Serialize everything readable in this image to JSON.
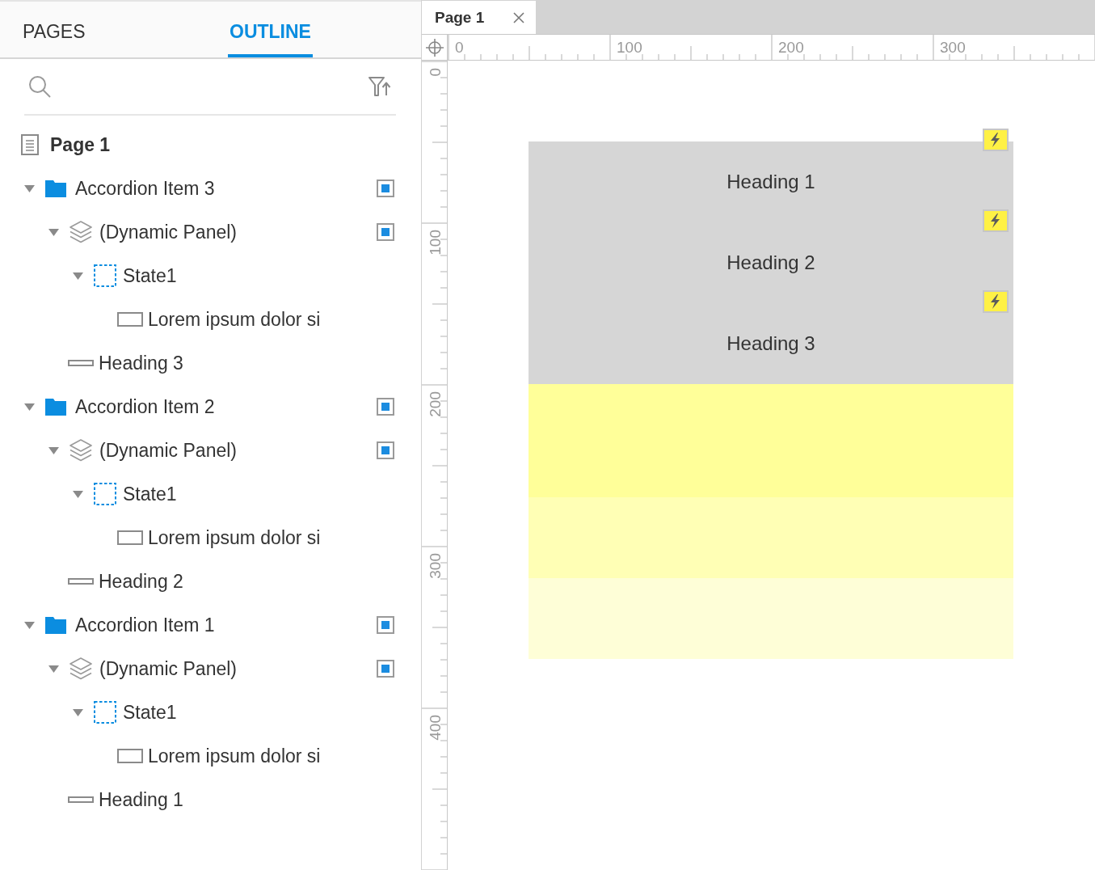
{
  "left_panel": {
    "tabs": [
      {
        "label": "PAGES",
        "selected": false
      },
      {
        "label": "OUTLINE",
        "selected": true
      }
    ]
  },
  "outline": {
    "page": {
      "label": "Page 1"
    },
    "items": [
      {
        "kind": "folder",
        "label": "Accordion Item 3",
        "expanded": true,
        "children": [
          {
            "kind": "dynamic_panel",
            "label": "(Dynamic Panel)",
            "expanded": true,
            "children": [
              {
                "kind": "state",
                "label": "State1",
                "expanded": true,
                "children": [
                  {
                    "kind": "rectangle",
                    "label": "Lorem ipsum dolor si"
                  }
                ]
              }
            ]
          },
          {
            "kind": "heading",
            "label": "Heading 3"
          }
        ]
      },
      {
        "kind": "folder",
        "label": "Accordion Item 2",
        "expanded": true,
        "children": [
          {
            "kind": "dynamic_panel",
            "label": "(Dynamic Panel)",
            "expanded": true,
            "children": [
              {
                "kind": "state",
                "label": "State1",
                "expanded": true,
                "children": [
                  {
                    "kind": "rectangle",
                    "label": "Lorem ipsum dolor si"
                  }
                ]
              }
            ]
          },
          {
            "kind": "heading",
            "label": "Heading 2"
          }
        ]
      },
      {
        "kind": "folder",
        "label": "Accordion Item 1",
        "expanded": true,
        "children": [
          {
            "kind": "dynamic_panel",
            "label": "(Dynamic Panel)",
            "expanded": true,
            "children": [
              {
                "kind": "state",
                "label": "State1",
                "expanded": true,
                "children": [
                  {
                    "kind": "rectangle",
                    "label": "Lorem ipsum dolor si"
                  }
                ]
              }
            ]
          },
          {
            "kind": "heading",
            "label": "Heading 1"
          }
        ]
      }
    ]
  },
  "editor": {
    "tabs": [
      {
        "label": "Page 1",
        "selected": true
      }
    ],
    "horizontal_ruler": [
      "0",
      "100",
      "200",
      "300"
    ],
    "vertical_ruler": [
      "0",
      "100",
      "200",
      "300",
      "400"
    ],
    "widgets": [
      {
        "kind": "heading",
        "label": "Heading 1",
        "has_interactions": true
      },
      {
        "kind": "heading",
        "label": "Heading 2",
        "has_interactions": true
      },
      {
        "kind": "heading",
        "label": "Heading 3",
        "has_interactions": true
      },
      {
        "kind": "panel",
        "color": "#ffff99"
      },
      {
        "kind": "panel",
        "color": "#ffffb5"
      },
      {
        "kind": "panel",
        "color": "#fefed7"
      }
    ]
  }
}
